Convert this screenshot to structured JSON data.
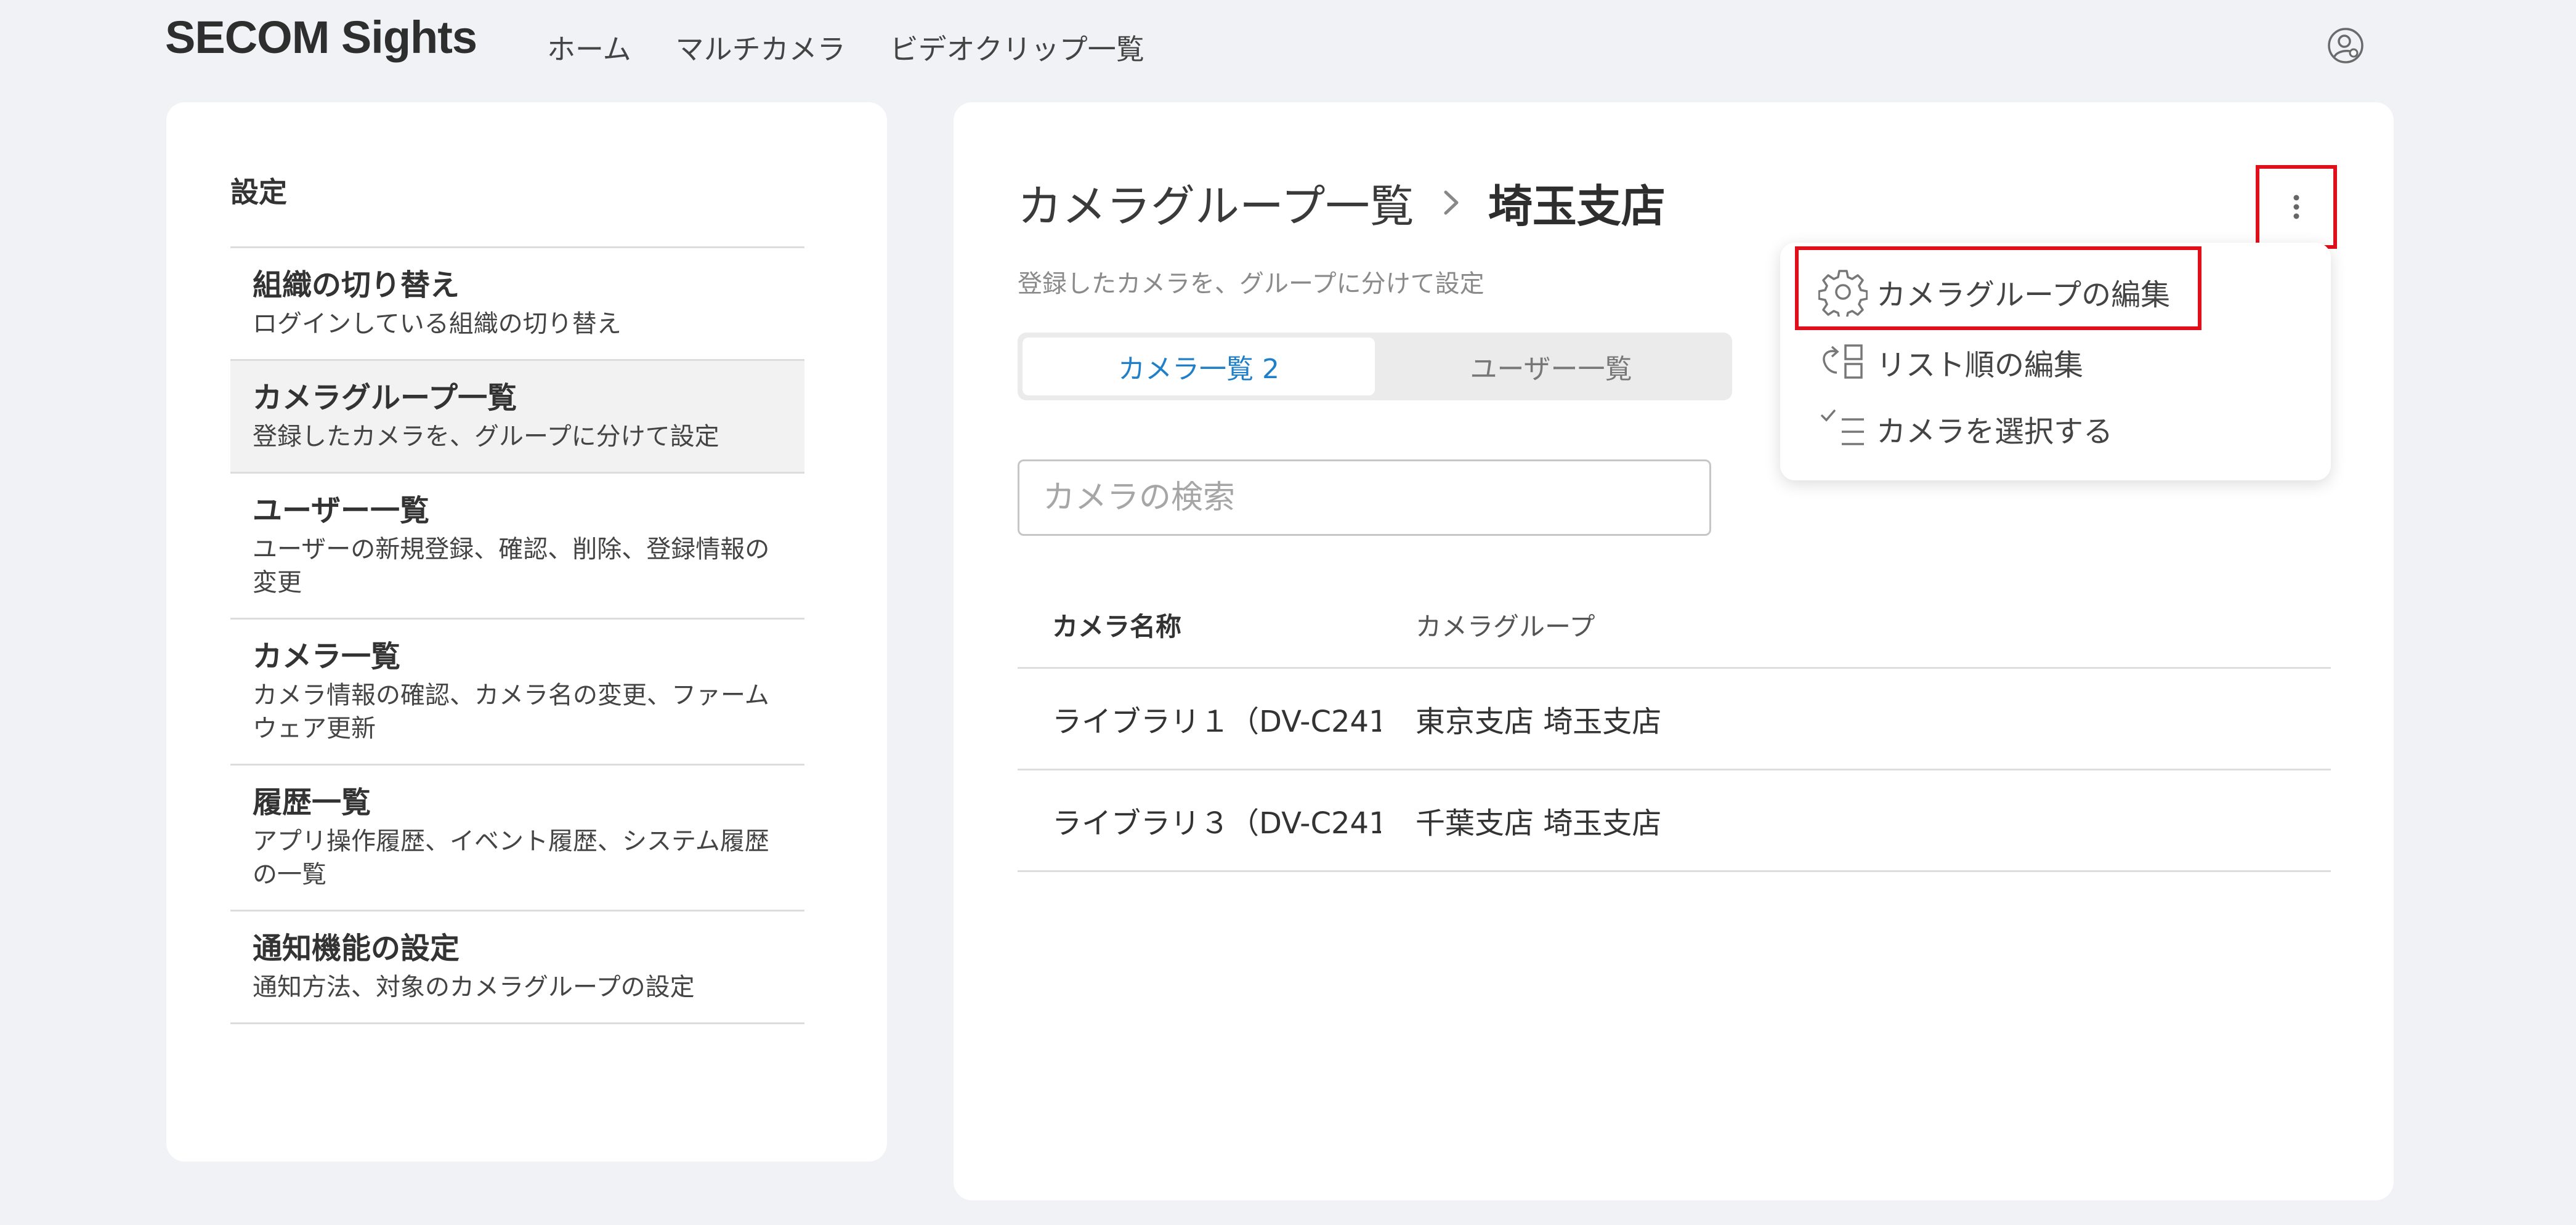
{
  "app": {
    "logo": "SECOM Sights"
  },
  "nav": {
    "items": [
      "ホーム",
      "マルチカメラ",
      "ビデオクリップ一覧"
    ]
  },
  "icons": {
    "user": "user-settings-icon",
    "breadcrumb_separator": "chevron-right-icon",
    "more": "vertical-dots-icon",
    "edit_group": "gear-icon",
    "reorder": "reorder-list-icon",
    "select": "checklist-icon"
  },
  "sidebar": {
    "heading": "設定",
    "items": [
      {
        "title": "組織の切り替え",
        "desc": "ログインしている組織の切り替え"
      },
      {
        "title": "カメラグループ一覧",
        "desc": "登録したカメラを、グループに分けて設定"
      },
      {
        "title": "ユーザー一覧",
        "desc": "ユーザーの新規登録、確認、削除、登録情報の変更"
      },
      {
        "title": "カメラ一覧",
        "desc": "カメラ情報の確認、カメラ名の変更、ファームウェア更新"
      },
      {
        "title": "履歴一覧",
        "desc": "アプリ操作履歴、イベント履歴、システム履歴の一覧"
      },
      {
        "title": "通知機能の設定",
        "desc": "通知方法、対象のカメラグループの設定"
      }
    ]
  },
  "main": {
    "breadcrumb": {
      "parent": "カメラグループ一覧",
      "current": "埼玉支店"
    },
    "subtitle": "登録したカメラを、グループに分けて設定",
    "tabs": [
      {
        "label": "カメラ一覧 2"
      },
      {
        "label": "ユーザー一覧"
      }
    ],
    "search": {
      "placeholder": "カメラの検索"
    },
    "table": {
      "headers": {
        "name": "カメラ名称",
        "group": "カメラグループ"
      },
      "rows": [
        {
          "name": "ライブラリ１（DV-C241",
          "group": "東京支店 埼玉支店"
        },
        {
          "name": "ライブラリ３（DV-C241",
          "group": "千葉支店 埼玉支店"
        }
      ]
    }
  },
  "menu": {
    "items": [
      {
        "label": "カメラグループの編集"
      },
      {
        "label": "リスト順の編集"
      },
      {
        "label": "カメラを選択する"
      }
    ]
  },
  "colors": {
    "background": "#f1f2f6",
    "card": "#ffffff",
    "accent": "#1f7fc8",
    "highlight": "#e0101a",
    "divider": "#dcdcdc"
  }
}
